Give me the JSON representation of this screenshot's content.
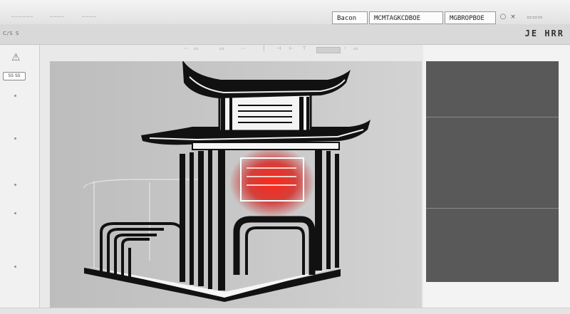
{
  "topbar": {
    "faint_labels": [
      "──────",
      "────",
      "────"
    ],
    "fields": [
      "Bacon",
      "MCMTAGKCDBOE",
      "MGBROPBOE"
    ],
    "icons": [
      "refresh-icon",
      "close-icon"
    ]
  },
  "subbar": {
    "left_label": "C/S S",
    "right_title": "JE HRR"
  },
  "sidebar": {
    "top_icon": "warning-icon",
    "button_label": "SS SS"
  },
  "canvas_toolbar": {
    "items": [
      "⋯",
      "▭",
      "▭",
      "⋯",
      "│",
      "⊣",
      "⊢",
      "⊤",
      "◦",
      "▭"
    ]
  },
  "viewport": {
    "subject": "3d-pagoda-gate-model",
    "accent": "#e8221b"
  },
  "right_panel": {
    "color": "#595959",
    "sections": 3
  }
}
